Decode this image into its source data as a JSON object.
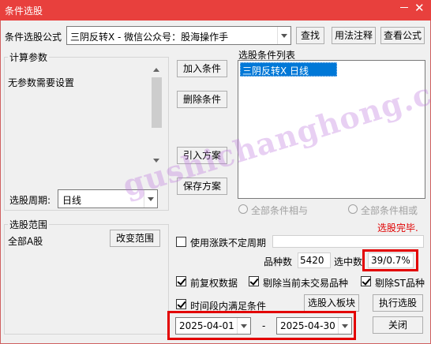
{
  "window": {
    "title": "条件选股"
  },
  "formula": {
    "label": "条件选股公式",
    "value": "三阴反转X  -  微信公众号：股海操作手",
    "find_btn": "查找",
    "usage_btn": "用法注释",
    "view_btn": "查看公式"
  },
  "params": {
    "group_label": "计算参数",
    "empty_text": "无参数需要设置",
    "period_label": "选股周期:",
    "period_value": "日线"
  },
  "conditions": {
    "add_btn": "加入条件",
    "remove_btn": "删除条件",
    "import_btn": "引入方案",
    "save_btn": "保存方案",
    "list_label": "选股条件列表",
    "items": [
      {
        "label": "三阴反转X  日线",
        "selected": true
      }
    ],
    "radio_and": "全部条件相与",
    "radio_or": "全部条件相或",
    "status": "选股完毕."
  },
  "scope": {
    "group_label": "选股范围",
    "value": "全部A股",
    "change_btn": "改变范围"
  },
  "options": {
    "use_indefinite_period": "使用涨跌不定周期",
    "count_label": "品种数",
    "count_value": "5420",
    "selected_label": "选中数",
    "selected_value": "39/0.7%",
    "pre_adjust": "前复权数据",
    "exclude_untraded": "剔除当前未交易品种",
    "exclude_st": "剔除ST品种",
    "time_range_label": "时间段内满足条件",
    "to_block_btn": "选股入板块",
    "execute_btn": "执行选股",
    "date_from": "2025-04-01",
    "date_sep": "-",
    "date_to": "2025-04-30",
    "close_btn": "关闭"
  },
  "watermark": {
    "text": "gushichanghong.com"
  },
  "colors": {
    "titlebar": "#e8403d",
    "selection": "#0078d7",
    "highlight_box": "#e30000",
    "status_text": "#e00000"
  }
}
